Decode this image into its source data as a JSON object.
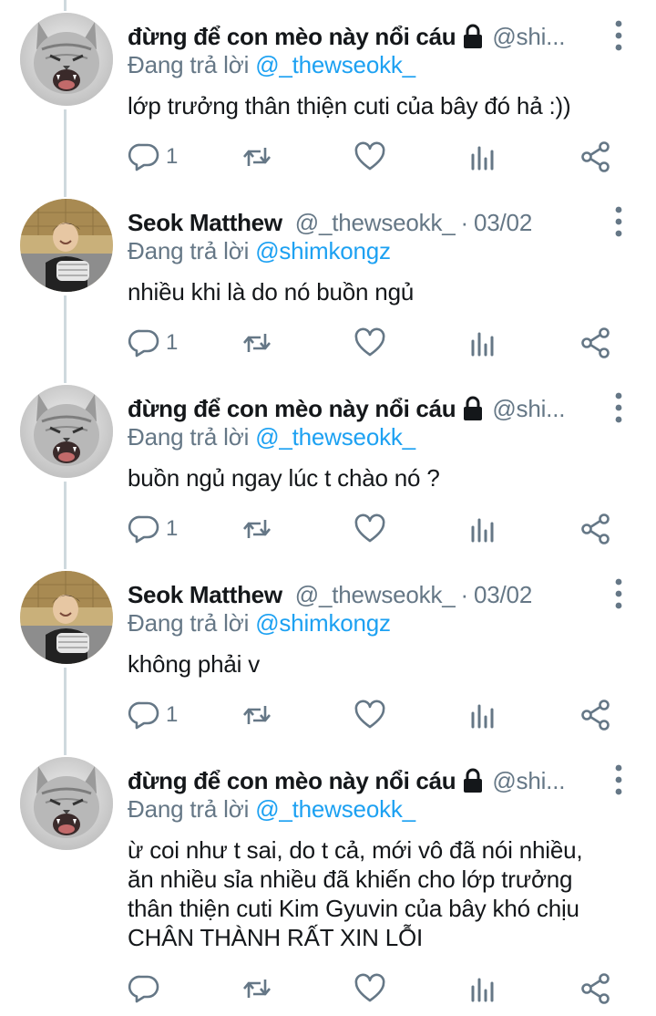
{
  "accent_color": "#1da1f2",
  "muted_color": "#657786",
  "tweets": [
    {
      "display_name": "đừng để con mèo này nổi cáu",
      "locked": true,
      "handle": "@shi...",
      "separator": "",
      "date": "",
      "reply_prefix": "Đang trả lời",
      "reply_to": "@_thewseokk_",
      "avatar": "cat-avatar",
      "body_lines": [
        "lớp trưởng thân thiện cuti của bây đó hả :))"
      ],
      "reply_count": "1"
    },
    {
      "display_name": "Seok Matthew",
      "locked": false,
      "handle": "@_thewseokk_",
      "separator": "·",
      "date": "03/02",
      "reply_prefix": "Đang trả lời",
      "reply_to": "@shimkongz",
      "avatar": "person-avatar",
      "body_lines": [
        "nhiều khi là do nó buồn ngủ"
      ],
      "reply_count": "1"
    },
    {
      "display_name": "đừng để con mèo này nổi cáu",
      "locked": true,
      "handle": "@shi...",
      "separator": "",
      "date": "",
      "reply_prefix": "Đang trả lời",
      "reply_to": "@_thewseokk_",
      "avatar": "cat-avatar",
      "body_lines": [
        "buồn ngủ ngay lúc t chào nó ?"
      ],
      "reply_count": "1"
    },
    {
      "display_name": "Seok Matthew",
      "locked": false,
      "handle": "@_thewseokk_",
      "separator": "·",
      "date": "03/02",
      "reply_prefix": "Đang trả lời",
      "reply_to": "@shimkongz",
      "avatar": "person-avatar",
      "body_lines": [
        "không phải v"
      ],
      "reply_count": "1"
    },
    {
      "display_name": "đừng để con mèo này nổi cáu",
      "locked": true,
      "handle": "@shi...",
      "separator": "",
      "date": "",
      "reply_prefix": "Đang trả lời",
      "reply_to": "@_thewseokk_",
      "avatar": "cat-avatar",
      "body_lines": [
        "ừ coi như t sai, do t cả, mới vô đã nói nhiều,",
        "ăn nhiều sỉa nhiều đã khiến cho lớp trưởng",
        "thân thiện cuti Kim Gyuvin của bây khó chịu",
        "CHÂN THÀNH RẤT XIN LỖI"
      ],
      "reply_count": ""
    }
  ]
}
